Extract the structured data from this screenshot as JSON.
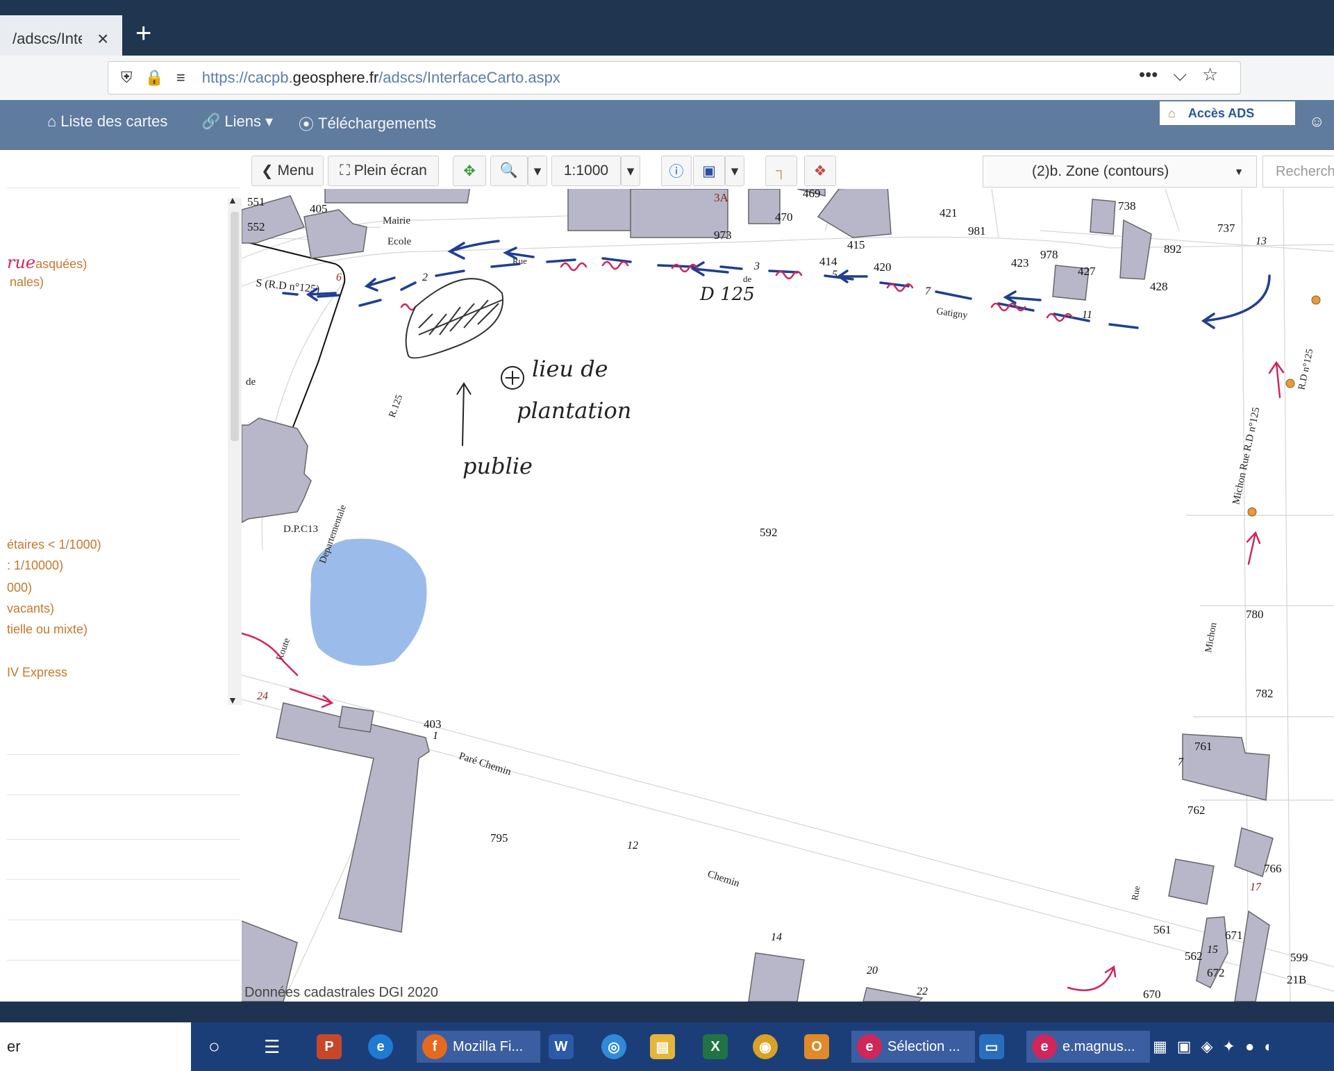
{
  "browser": {
    "tab_title": "/adscs/Inte",
    "tab_close": "×",
    "new_tab": "+",
    "url_prefix": "https://cacpb.",
    "url_domain": "geosphere.fr",
    "url_suffix": "/adscs/InterfaceCarto.aspx",
    "menu_dots": "•••"
  },
  "app_nav": {
    "items": [
      {
        "label": "Liste des cartes",
        "icon": "home-icon"
      },
      {
        "label": "Liens",
        "icon": "link-icon"
      },
      {
        "label": "Téléchargements",
        "icon": "download-icon"
      }
    ],
    "acces_ads": "Accès ADS"
  },
  "left_panel": {
    "items": [
      "asquées)",
      "nales)",
      "étaires < 1/1000)",
      ": 1/10000)",
      "000)",
      "vacants)",
      "tielle ou mixte)",
      "IV Express"
    ]
  },
  "map_toolbar": {
    "menu": "Menu",
    "fullscreen": "Plein écran",
    "scale": "1:1000",
    "layer": "(2)b. Zone (contours)",
    "search_placeholder": "Recherch"
  },
  "map": {
    "credit": "Données cadastrales DGI 2020",
    "parcels": [
      "551",
      "405",
      "552",
      "3A",
      "469",
      "470",
      "973",
      "421",
      "981",
      "738",
      "737",
      "892",
      "415",
      "414",
      "420",
      "423",
      "978",
      "427",
      "428",
      "592",
      "780",
      "782",
      "761",
      "762",
      "766",
      "561",
      "562",
      "671",
      "672",
      "599",
      "21B",
      "670",
      "795",
      "403"
    ],
    "street_numbers": [
      "6",
      "2",
      "3",
      "5",
      "7",
      "11",
      "13",
      "1",
      "24",
      "12",
      "14",
      "20",
      "22",
      "7",
      "15",
      "17"
    ],
    "labels": {
      "mairie": "Mairie",
      "ecole": "Ecole",
      "rd125_a": "S  (R.D n°125)",
      "rue_de": "Rue",
      "de": "de",
      "gatigny": "Gatigny",
      "de_left": "de",
      "r125": "R.125",
      "departementale": "Departementale",
      "dp": "D.P.C13",
      "pare_chemin": "Paré Chemin",
      "chemin": "Chemin",
      "michon_rue": "Michon Rue R.D n°125",
      "rd125_b": "R.D n°125",
      "michon": "Michon",
      "rue": "Rue",
      "route": "Route"
    },
    "handwriting": {
      "d125": "D 125",
      "lieu_de": "lieu de",
      "plantation": "plantation",
      "publie": "publie",
      "scribble": "rue"
    }
  },
  "taskbar": {
    "search": "er",
    "items": [
      {
        "label": "Mozilla Fi...",
        "icon": "firefox-icon"
      },
      {
        "label": "Sélection ...",
        "icon": "edge-icon"
      },
      {
        "label": "e.magnus...",
        "icon": "edge-icon"
      }
    ]
  },
  "colors": {
    "nav_bg": "#5f7b9e",
    "building": "#b7b7c9",
    "arrow_blue": "#1f3f8f",
    "handwriting_red": "#d0265a",
    "pond": "#9bbcea"
  }
}
